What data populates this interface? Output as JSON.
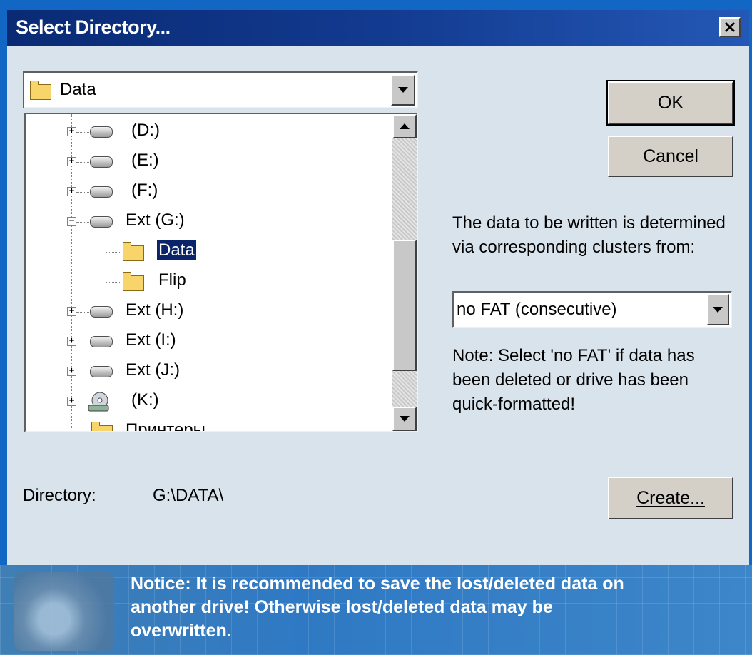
{
  "window": {
    "title": "Select Directory..."
  },
  "folder_combo": {
    "value": "Data"
  },
  "tree": {
    "items": [
      {
        "label": "(D:)"
      },
      {
        "label": "(E:)"
      },
      {
        "label": "(F:)"
      },
      {
        "label": "Ext (G:)"
      },
      {
        "label": "Data"
      },
      {
        "label": "Flip"
      },
      {
        "label": "Ext (H:)"
      },
      {
        "label": "Ext (I:)"
      },
      {
        "label": "Ext (J:)"
      },
      {
        "label": "(K:)"
      },
      {
        "label": "Принтеры"
      }
    ]
  },
  "buttons": {
    "ok": "OK",
    "cancel": "Cancel",
    "create": "Create..."
  },
  "info": {
    "line1": "The data to be written is determined",
    "line2": "via corresponding clusters from:"
  },
  "fat_select": {
    "value": "no FAT (consecutive)"
  },
  "note": {
    "line1": "Note: Select 'no FAT' if data has",
    "line2": "been deleted or drive has been",
    "line3": "quick-formatted!"
  },
  "directory": {
    "label": "Directory:",
    "value": "G:\\DATA\\"
  },
  "notice": {
    "line1": "Notice: It is recommended to save the lost/deleted data on",
    "line2": "another drive! Otherwise lost/deleted data may be",
    "line3": "overwritten."
  }
}
